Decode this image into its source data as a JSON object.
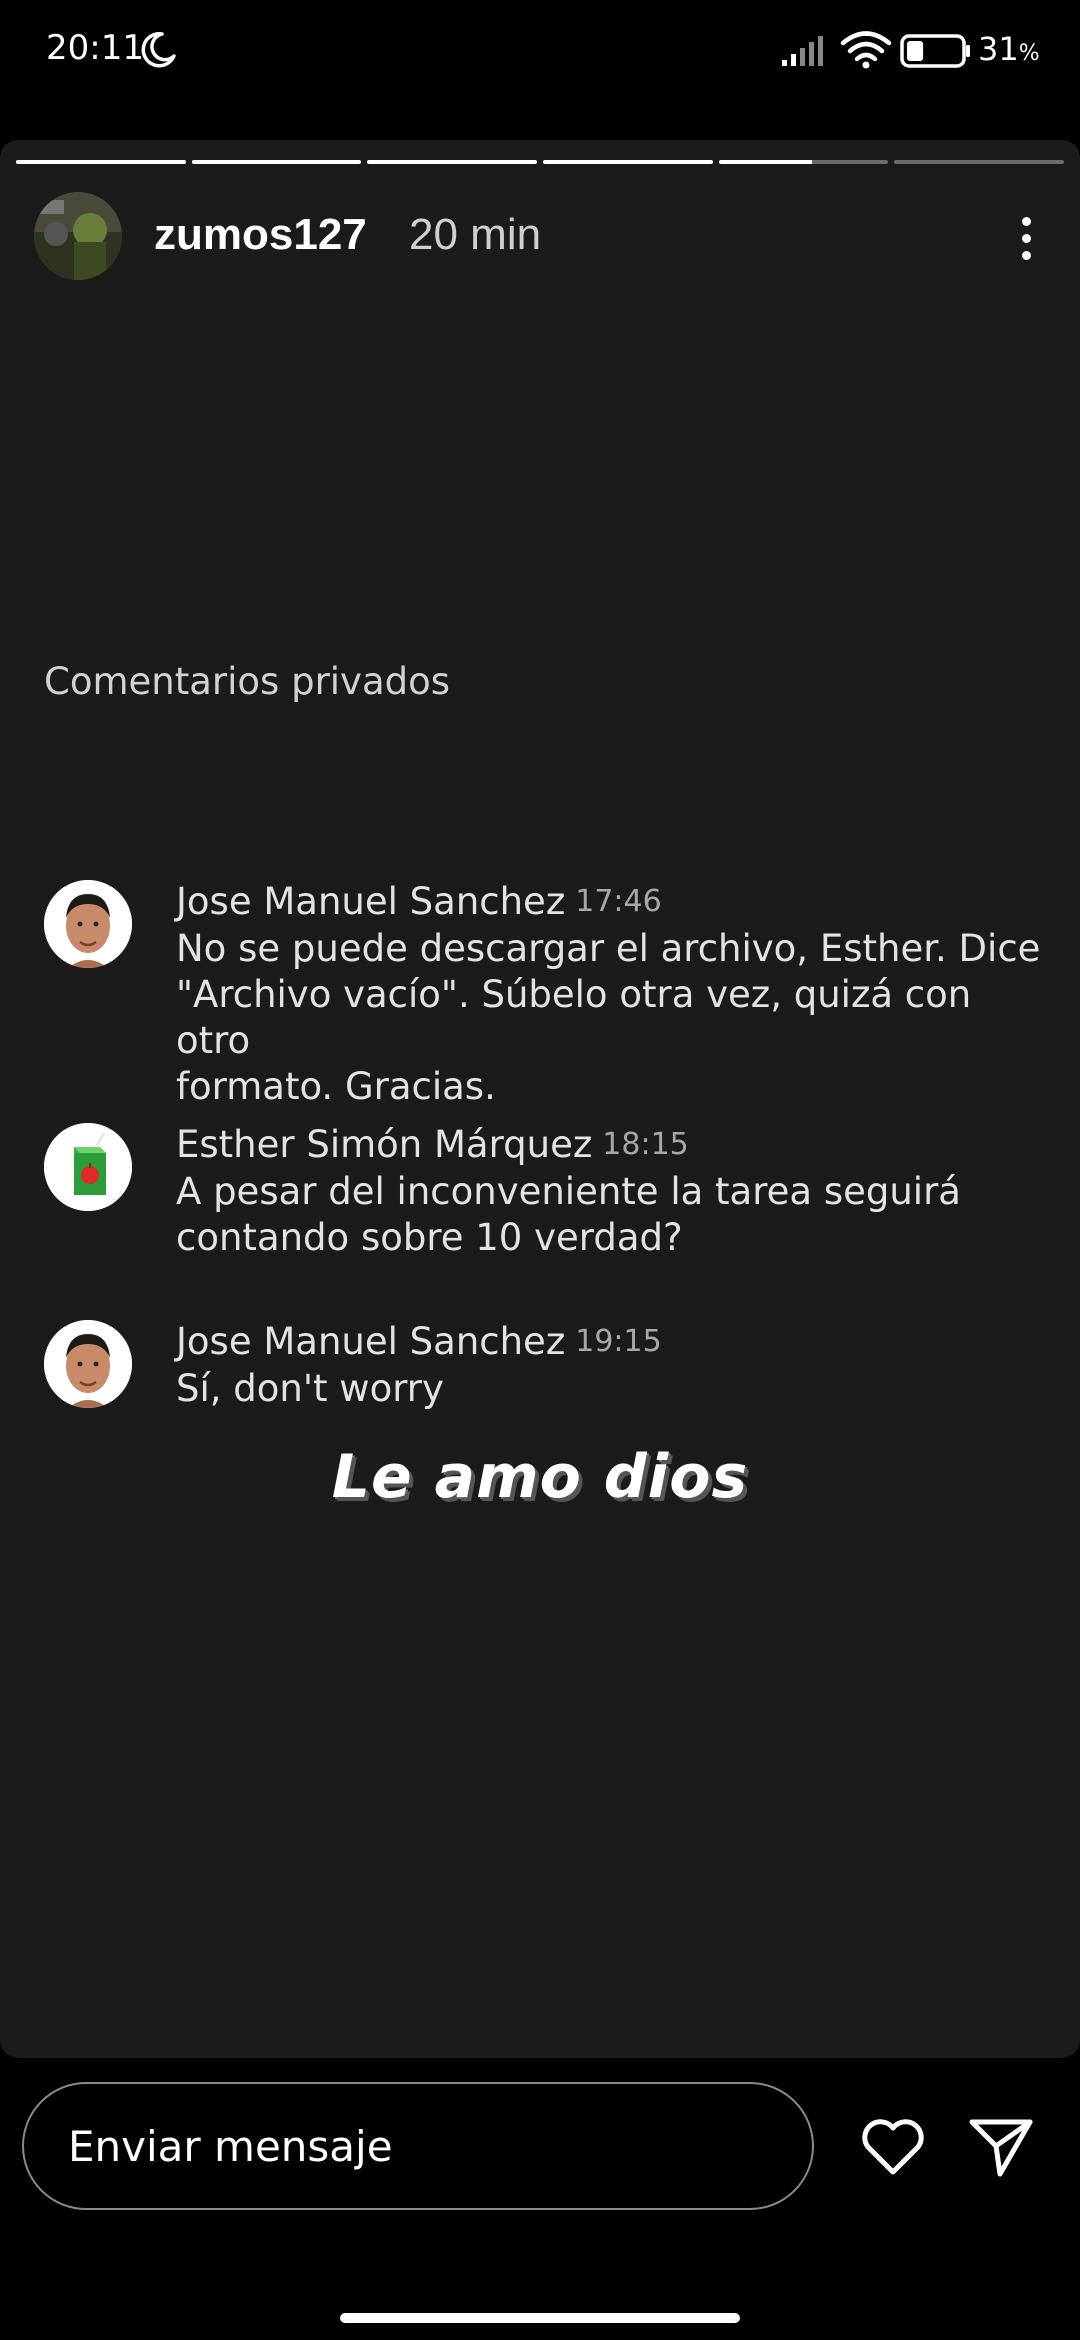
{
  "status_bar": {
    "time": "20:11",
    "battery_percent": "31",
    "battery_suffix": "%",
    "battery_level": 0.31,
    "icons": [
      "moon-icon",
      "signal-icon",
      "wifi-icon",
      "battery-icon"
    ]
  },
  "story": {
    "progress": [
      1,
      1,
      1,
      1,
      0.55,
      0
    ],
    "username": "zumos127",
    "time_ago": "20 min",
    "more_icon": "vertical-ellipsis-icon"
  },
  "comments": {
    "title": "Comentarios privados",
    "items": [
      {
        "author": "Jose Manuel Sanchez",
        "time": "17:46",
        "text": "No se puede descargar el archivo, Esther. Dice\n\"Archivo vacío\". Súbelo otra vez, quizá con otro\nformato. Gracias.",
        "avatar": "person-avatar"
      },
      {
        "author": "Esther Simón Márquez",
        "time": "18:15",
        "text": "A pesar del inconveniente la tarea seguirá\ncontando sobre 10 verdad?",
        "avatar": "juice-box-avatar"
      },
      {
        "author": "Jose Manuel Sanchez",
        "time": "19:15",
        "text": "Sí, don't worry",
        "avatar": "person-avatar"
      }
    ]
  },
  "caption": "Le amo dios",
  "bottom_bar": {
    "message_placeholder": "Enviar mensaje",
    "like_icon": "heart-icon",
    "send_icon": "send-icon"
  },
  "colors": {
    "background": "#000000",
    "card": "#1b1b1b",
    "text": "#ffffff",
    "muted": "#a8a8a8"
  }
}
